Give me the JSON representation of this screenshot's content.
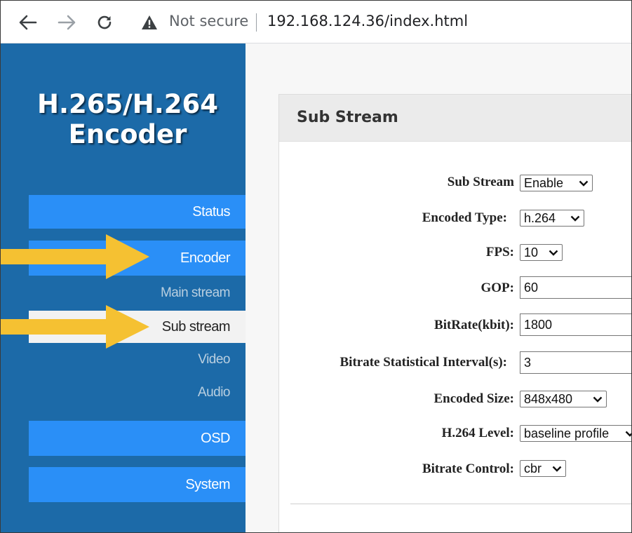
{
  "browser": {
    "back_icon": "arrow-left-icon",
    "forward_icon": "arrow-right-icon",
    "reload_icon": "reload-icon",
    "warning_icon": "warning-triangle-icon",
    "security_label": "Not secure",
    "url": "192.168.124.36/index.html"
  },
  "sidebar": {
    "logo_line1": "H.265/H.264",
    "logo_line2": "Encoder",
    "items": [
      {
        "label": "Status",
        "type": "main"
      },
      {
        "label": "Encoder",
        "type": "main"
      },
      {
        "label": "Main stream",
        "type": "sub"
      },
      {
        "label": "Sub stream",
        "type": "sub",
        "active": true
      },
      {
        "label": "Video",
        "type": "sub"
      },
      {
        "label": "Audio",
        "type": "sub"
      },
      {
        "label": "OSD",
        "type": "main"
      },
      {
        "label": "System",
        "type": "main"
      }
    ]
  },
  "panel": {
    "title": "Sub Stream",
    "fields": {
      "sub_stream": {
        "label": "Sub Stream",
        "value": "Enable"
      },
      "encoded_type": {
        "label": "Encoded Type:",
        "value": "h.264"
      },
      "fps": {
        "label": "FPS:",
        "value": "10"
      },
      "gop": {
        "label": "GOP:",
        "value": "60"
      },
      "bitrate": {
        "label": "BitRate(kbit):",
        "value": "1800"
      },
      "interval": {
        "label": "Bitrate Statistical Interval(s):",
        "value": "3"
      },
      "encoded_size": {
        "label": "Encoded Size:",
        "value": "848x480"
      },
      "h264_level": {
        "label": "H.264 Level:",
        "value": "baseline profile"
      },
      "bitrate_control": {
        "label": "Bitrate Control:",
        "value": "cbr"
      }
    }
  },
  "colors": {
    "sidebar_bg": "#1c6aa8",
    "menu_button": "#2a8ff7",
    "arrow": "#f5c132"
  }
}
